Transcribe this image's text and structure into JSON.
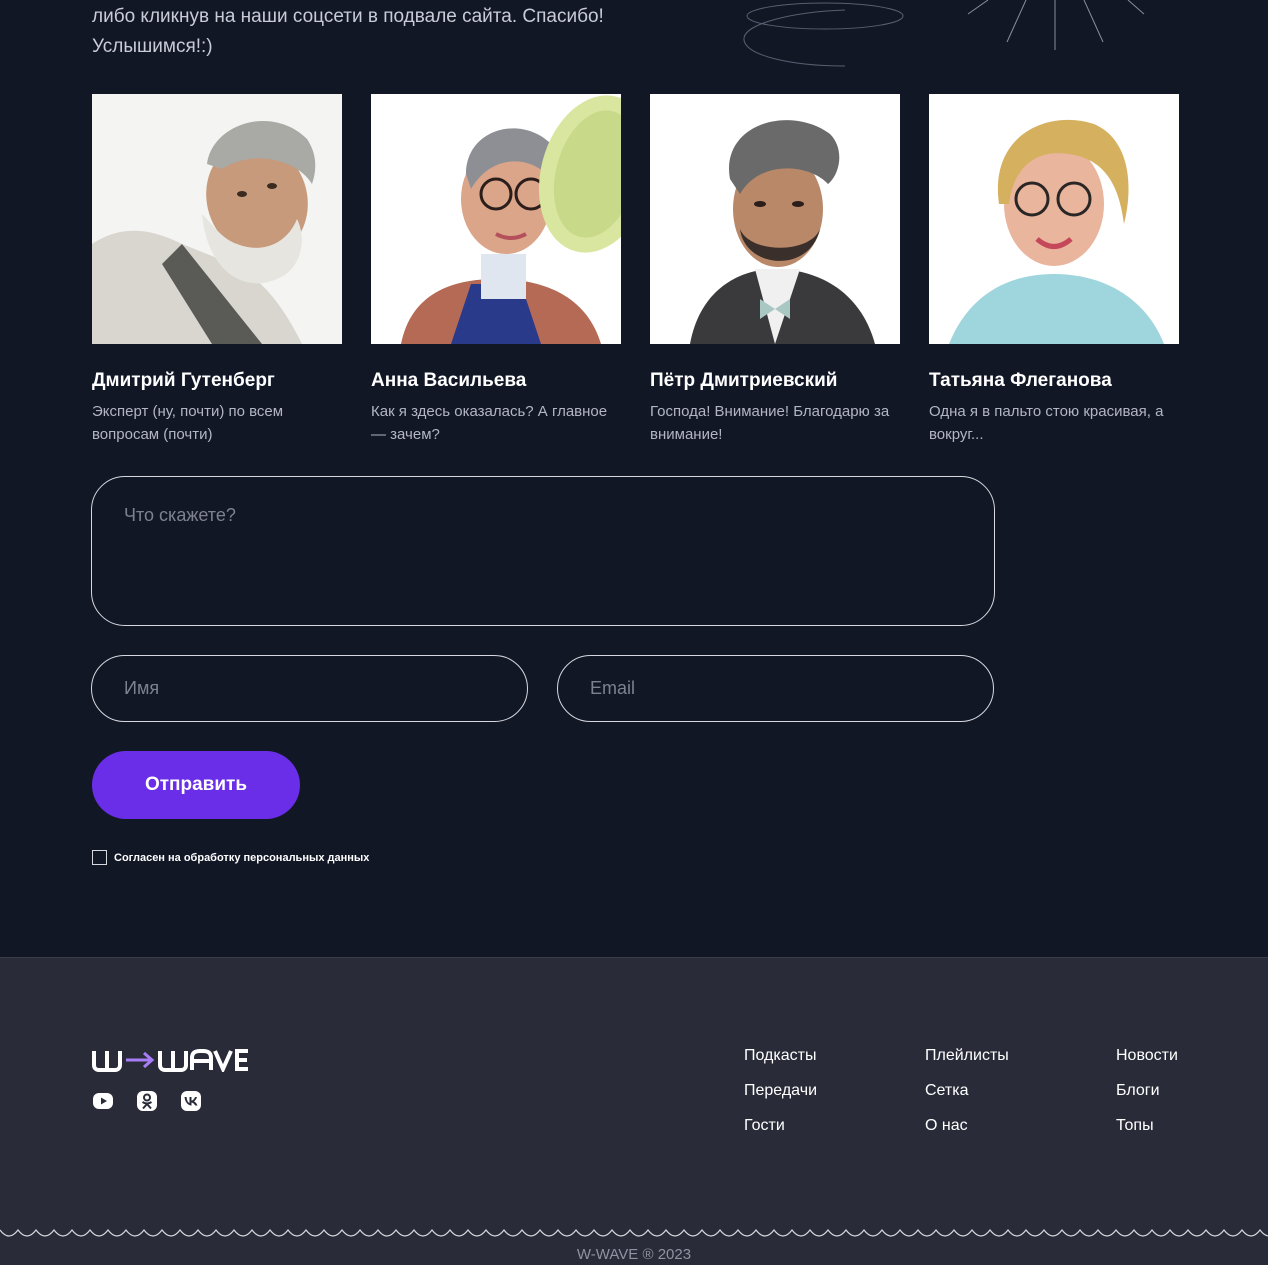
{
  "intro": {
    "line1": "либо кликнув на наши соцсети в подвале сайта. Спасибо!",
    "line2": "Услышимся!:)"
  },
  "guests": [
    {
      "name": "Дмитрий Гутенберг",
      "desc": "Эксперт (ну, почти) по всем вопросам (почти)"
    },
    {
      "name": "Анна Васильева",
      "desc": "Как я здесь оказалась? А главное — зачем?"
    },
    {
      "name": "Пётр Дмитриевский",
      "desc": "Господа! Внимание! Благодарю за внимание!"
    },
    {
      "name": "Татьяна Флеганова",
      "desc": "Одна я в пальто стою красивая, а вокруг..."
    }
  ],
  "form": {
    "message_placeholder": "Что скажете?",
    "name_placeholder": "Имя",
    "email_placeholder": "Email",
    "submit_label": "Отправить",
    "consent_label": "Согласен на обработку персональных данных"
  },
  "footer": {
    "logo_text": "W→WAVE",
    "socials": [
      "youtube-icon",
      "odnoklassniki-icon",
      "vk-icon"
    ],
    "nav": {
      "col1": [
        "Подкасты",
        "Передачи",
        "Гости"
      ],
      "col2": [
        "Плейлисты",
        "Сетка",
        "О нас"
      ],
      "col3": [
        "Новости",
        "Блоги",
        "Топы"
      ]
    },
    "copyright": "W-WAVE ® 2023"
  },
  "colors": {
    "background": "#121726",
    "footer": "#292c38",
    "accent": "#6a2ee8"
  }
}
